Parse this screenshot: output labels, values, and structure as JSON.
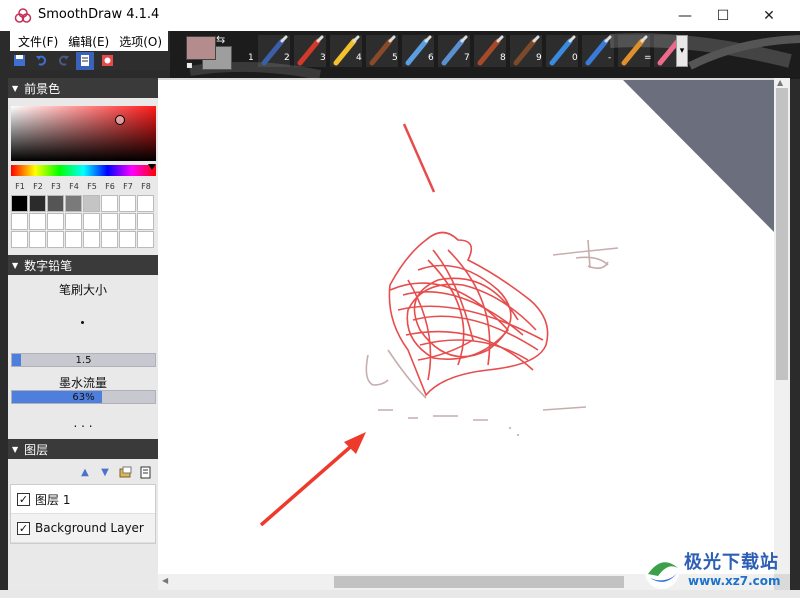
{
  "window": {
    "title": "SmoothDraw 4.1.4",
    "controls": {
      "minimize": "—",
      "maximize": "☐",
      "close": "✕"
    }
  },
  "menu": [
    {
      "label": "文件(F)"
    },
    {
      "label": "编辑(E)"
    },
    {
      "label": "选项(O)"
    }
  ],
  "colors": {
    "foreground": "#b58c8c",
    "background": "#9e9e9e",
    "accent": "#4f7fdc"
  },
  "tools": [
    {
      "num": "1",
      "icon": "pen-icon"
    },
    {
      "num": "2",
      "icon": "pencil-icon"
    },
    {
      "num": "3",
      "icon": "highlighter-icon"
    },
    {
      "num": "4",
      "icon": "brush-icon"
    },
    {
      "num": "5",
      "icon": "airbrush-icon"
    },
    {
      "num": "6",
      "icon": "spray-icon"
    },
    {
      "num": "7",
      "icon": "flat-brush-icon"
    },
    {
      "num": "8",
      "icon": "paint-brush-icon"
    },
    {
      "num": "9",
      "icon": "sparkle-icon"
    },
    {
      "num": "0",
      "icon": "water-drop-icon"
    },
    {
      "num": "-",
      "icon": "smudge-icon"
    },
    {
      "num": "=",
      "icon": "eraser-icon"
    }
  ],
  "panels": {
    "foreground_color": {
      "title": "前景色",
      "fkeys": [
        "F1",
        "F2",
        "F3",
        "F4",
        "F5",
        "F6",
        "F7",
        "F8"
      ],
      "palette": [
        "#000000",
        "#2b2b2b",
        "#555555",
        "#7a7a7a",
        "#c4c4c4",
        "#ffffff",
        "#ffffff",
        "#ffffff"
      ]
    },
    "brush": {
      "title": "数字铅笔",
      "size_label": "笔刷大小",
      "size_value": "1.5",
      "size_fraction": 0.06,
      "flow_label": "墨水流量",
      "flow_value": "63%",
      "flow_fraction": 0.63,
      "more": ". . ."
    },
    "layers": {
      "title": "图层",
      "items": [
        {
          "name": "图层 1",
          "visible": "✓"
        },
        {
          "name": "Background Layer",
          "visible": "✓"
        }
      ]
    }
  },
  "watermark": {
    "text": "极光下载站",
    "url": "www.xz7.com"
  }
}
